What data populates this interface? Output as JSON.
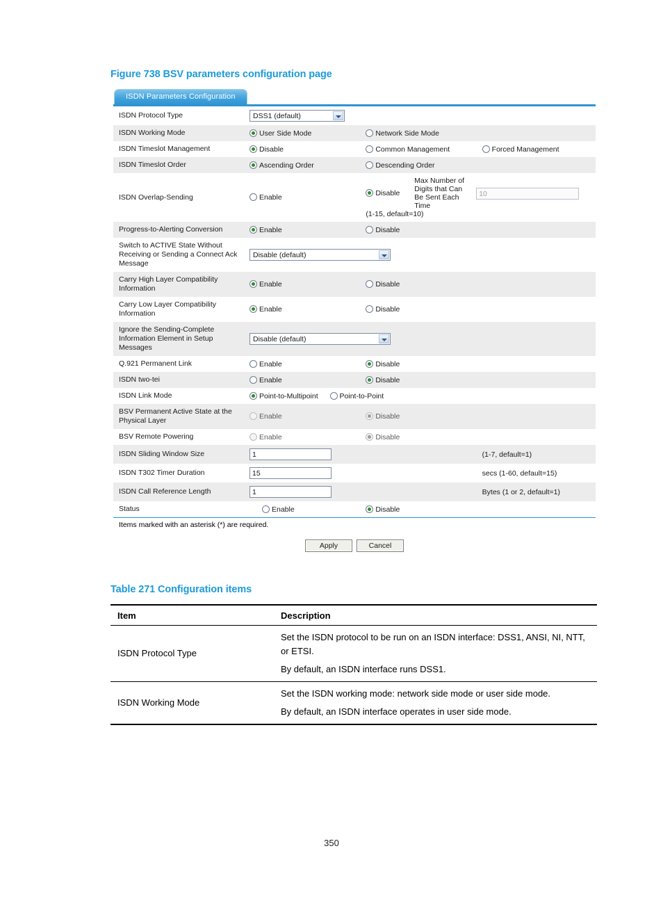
{
  "figure": {
    "caption": "Figure 738 BSV parameters configuration page"
  },
  "screenshot": {
    "tab_label": "ISDN Parameters Configuration",
    "rows": [
      {
        "label": "ISDN Protocol Type",
        "select_value": "DSS1 (default)"
      },
      {
        "label": "ISDN Working Mode",
        "opt1": "User Side Mode",
        "opt2": "Network Side Mode"
      },
      {
        "label": "ISDN Timeslot Management",
        "opt1": "Disable",
        "opt2": "Common Management",
        "opt3": "Forced Management"
      },
      {
        "label": "ISDN Timeslot Order",
        "opt1": "Ascending Order",
        "opt2": "Descending Order"
      },
      {
        "label": "ISDN Overlap-Sending",
        "opt1": "Enable",
        "opt2": "Disable",
        "sublabel": "Max Number of Digits that Can Be Sent Each Time",
        "value": "10",
        "hint": "(1-15, default=10)"
      },
      {
        "label": "Progress-to-Alerting Conversion",
        "opt1": "Enable",
        "opt2": "Disable"
      },
      {
        "label": "Switch to ACTIVE State Without Receiving or Sending a Connect Ack Message",
        "select_value": "Disable (default)"
      },
      {
        "label": "Carry High Layer Compatibility Information",
        "opt1": "Enable",
        "opt2": "Disable"
      },
      {
        "label": "Carry Low Layer Compatibility Information",
        "opt1": "Enable",
        "opt2": "Disable"
      },
      {
        "label": "Ignore the Sending-Complete Information Element in Setup Messages",
        "select_value": "Disable (default)"
      },
      {
        "label": "Q.921 Permanent Link",
        "opt1": "Enable",
        "opt2": "Disable"
      },
      {
        "label": "ISDN two-tei",
        "opt1": "Enable",
        "opt2": "Disable"
      },
      {
        "label": "ISDN Link Mode",
        "opt1": "Point-to-Multipoint",
        "opt2": "Point-to-Point"
      },
      {
        "label": "BSV Permanent Active State at the Physical Layer",
        "opt1": "Enable",
        "opt2": "Disable"
      },
      {
        "label": "BSV Remote Powering",
        "opt1": "Enable",
        "opt2": "Disable"
      },
      {
        "label": "ISDN Sliding Window Size",
        "value": "1",
        "hint": "(1-7, default=1)"
      },
      {
        "label": "ISDN T302 Timer Duration",
        "value": "15",
        "hint": "secs (1-60, default=15)"
      },
      {
        "label": "ISDN Call Reference Length",
        "value": "1",
        "hint": "Bytes (1 or 2, default=1)"
      },
      {
        "label": "Status",
        "opt1": "Enable",
        "opt2": "Disable"
      }
    ],
    "asterisk_note": "Items marked with an asterisk (*) are required.",
    "apply_label": "Apply",
    "cancel_label": "Cancel"
  },
  "table": {
    "caption": "Table 271 Configuration items",
    "headers": {
      "item": "Item",
      "description": "Description"
    },
    "rows": [
      {
        "item": "ISDN Protocol Type",
        "desc1": "Set the ISDN protocol to be run on an ISDN interface: DSS1, ANSI, NI, NTT, or ETSI.",
        "desc2": "By default, an ISDN interface runs DSS1."
      },
      {
        "item": "ISDN Working Mode",
        "desc1": "Set the ISDN working mode: network side mode or user side mode.",
        "desc2": "By default, an ISDN interface operates in user side mode."
      }
    ]
  },
  "page_number": "350",
  "colors": {
    "caption_blue": "#1d9bd7",
    "tab_blue": "#2e93d2",
    "row_alt": "#ececec",
    "radio_dot_green": "#2e8b2e"
  }
}
